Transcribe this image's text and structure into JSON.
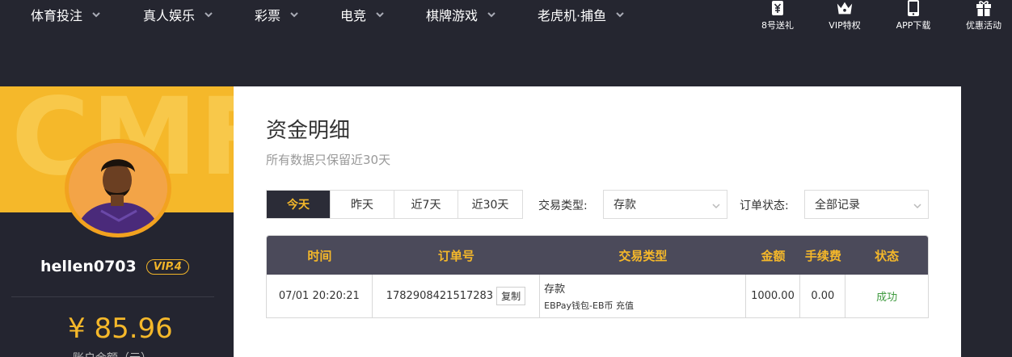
{
  "nav": {
    "items": [
      {
        "label": "体育投注"
      },
      {
        "label": "真人娱乐"
      },
      {
        "label": "彩票"
      },
      {
        "label": "电竞"
      },
      {
        "label": "棋牌游戏"
      },
      {
        "label": "老虎机·捕鱼"
      }
    ],
    "utilities": [
      {
        "label": "8号送礼",
        "icon": "ticket-yen-icon"
      },
      {
        "label": "VIP特权",
        "icon": "crown-icon"
      },
      {
        "label": "APP下载",
        "icon": "phone-icon"
      },
      {
        "label": "优惠活动",
        "icon": "gift-icon"
      }
    ]
  },
  "profile": {
    "watermark": "CMF",
    "username": "hellen0703",
    "vip": "VIP.4",
    "balance": "¥ 85.96",
    "balance_label": "账户余额（元）"
  },
  "main": {
    "title": "资金明细",
    "subtitle": "所有数据只保留近30天",
    "tabs": [
      {
        "label": "今天",
        "active": true
      },
      {
        "label": "昨天",
        "active": false
      },
      {
        "label": "近7天",
        "active": false
      },
      {
        "label": "近30天",
        "active": false
      }
    ],
    "filters": {
      "type_label": "交易类型:",
      "type_value": "存款",
      "status_label": "订单状态:",
      "status_value": "全部记录"
    },
    "table": {
      "headers": [
        "时间",
        "订单号",
        "交易类型",
        "金额",
        "手续费",
        "状态"
      ],
      "copy_label": "复制",
      "rows": [
        {
          "time": "07/01 20:20:21",
          "order_no": "1782908421517283",
          "type_main": "存款",
          "type_detail": "EBPay钱包-EB币 充值",
          "amount": "1000.00",
          "fee": "0.00",
          "status": "成功"
        }
      ]
    }
  },
  "colors": {
    "accent": "#f5b82a",
    "dark": "#252630",
    "success": "#3f9a3f"
  }
}
